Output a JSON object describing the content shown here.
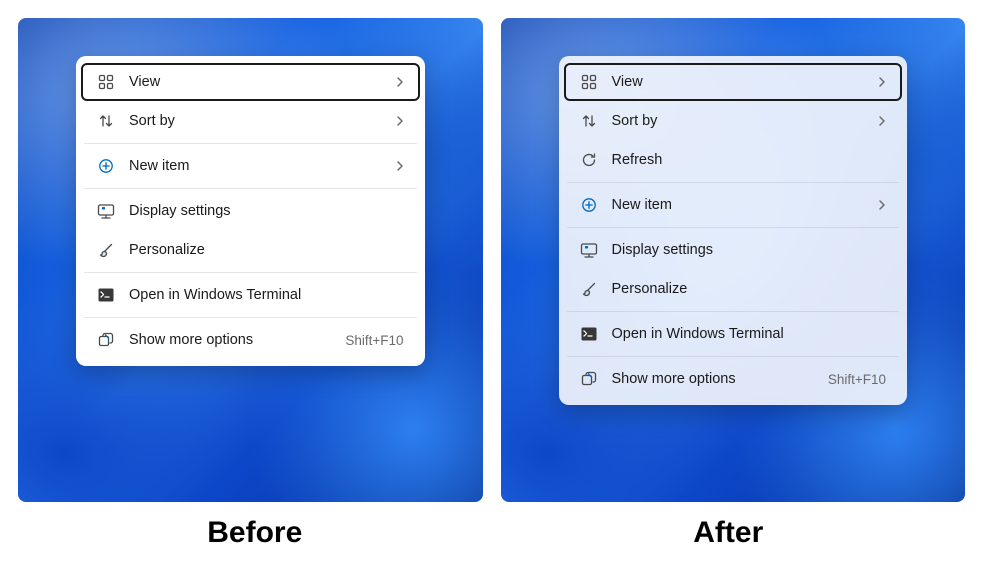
{
  "captions": {
    "before": "Before",
    "after": "After"
  },
  "menuBefore": {
    "items": [
      {
        "label": "View",
        "icon": "grid-icon",
        "chevron": true,
        "highlighted": true
      },
      {
        "label": "Sort by",
        "icon": "sort-icon",
        "chevron": true
      },
      {
        "separator": true
      },
      {
        "label": "New item",
        "icon": "new-icon",
        "chevron": true
      },
      {
        "separator": true
      },
      {
        "label": "Display settings",
        "icon": "display-icon"
      },
      {
        "label": "Personalize",
        "icon": "brush-icon"
      },
      {
        "separator": true
      },
      {
        "label": "Open in Windows Terminal",
        "icon": "terminal-icon"
      },
      {
        "separator": true
      },
      {
        "label": "Show more options",
        "icon": "more-icon",
        "shortcut": "Shift+F10"
      }
    ]
  },
  "menuAfter": {
    "items": [
      {
        "label": "View",
        "icon": "grid-icon",
        "chevron": true,
        "highlighted": true
      },
      {
        "label": "Sort by",
        "icon": "sort-icon",
        "chevron": true
      },
      {
        "label": "Refresh",
        "icon": "refresh-icon"
      },
      {
        "separator": true
      },
      {
        "label": "New item",
        "icon": "new-icon",
        "chevron": true
      },
      {
        "separator": true
      },
      {
        "label": "Display settings",
        "icon": "display-icon"
      },
      {
        "label": "Personalize",
        "icon": "brush-icon"
      },
      {
        "separator": true
      },
      {
        "label": "Open in Windows Terminal",
        "icon": "terminal-icon"
      },
      {
        "separator": true
      },
      {
        "label": "Show more options",
        "icon": "more-icon",
        "shortcut": "Shift+F10"
      }
    ]
  }
}
